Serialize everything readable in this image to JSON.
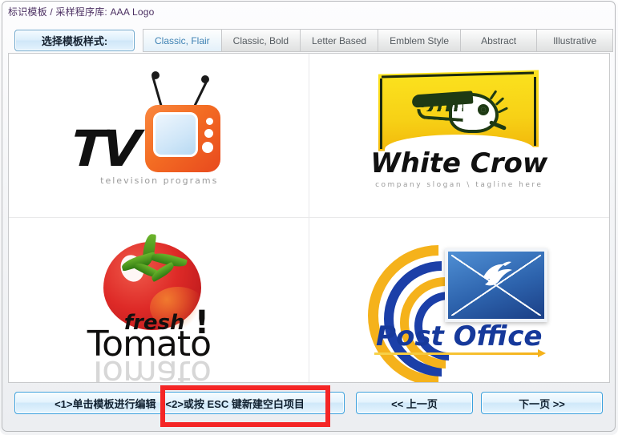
{
  "window": {
    "title": "标识模板 / 采样程序库: AAA Logo"
  },
  "toolbar": {
    "style_button_label": "选择模板样式:",
    "tabs": [
      {
        "label": "Classic, Flair",
        "active": true
      },
      {
        "label": "Classic, Bold",
        "active": false
      },
      {
        "label": "Letter Based",
        "active": false
      },
      {
        "label": "Emblem Style",
        "active": false
      },
      {
        "label": "Abstract",
        "active": false
      },
      {
        "label": "Illustrative",
        "active": false
      }
    ]
  },
  "templates": [
    {
      "name": "TV",
      "title": "TV",
      "tagline": "television programs",
      "accent": "#f26c23"
    },
    {
      "name": "White Crow",
      "title": "White Crow",
      "tagline": "company slogan \\ tagline here",
      "accent": "#f7d116"
    },
    {
      "name": "Tomato",
      "title": "Tomato",
      "sub": "fresh",
      "exclaim": "!",
      "accent": "#de2a27"
    },
    {
      "name": "Post Office",
      "title": "Post Office",
      "accent": "#16399b"
    }
  ],
  "footer": {
    "hint_part1": "<1>单击模板进行编辑",
    "hint_part2": "<2>或按 ESC 键新建空白项目",
    "prev_label": "<< 上一页",
    "next_label": "下一页 >>"
  },
  "annotation": {
    "color": "#f42626",
    "target": "<2>或按 ESC 键新建空白项目"
  }
}
